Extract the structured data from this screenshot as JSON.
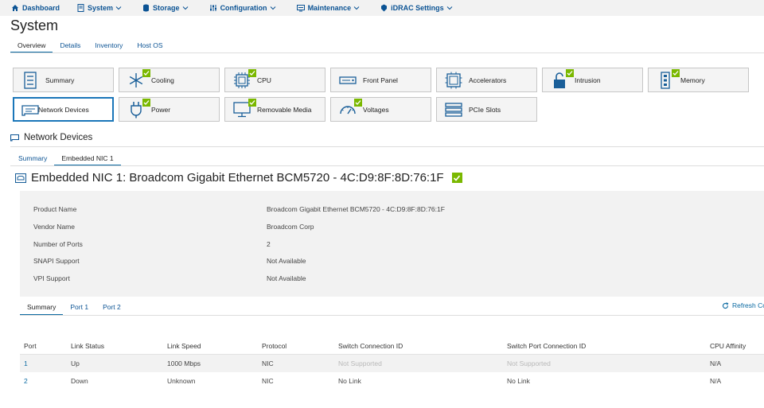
{
  "nav": [
    {
      "label": "Dashboard",
      "icon": "home-icon",
      "dropdown": false
    },
    {
      "label": "System",
      "icon": "server-icon",
      "dropdown": true
    },
    {
      "label": "Storage",
      "icon": "database-icon",
      "dropdown": true
    },
    {
      "label": "Configuration",
      "icon": "sliders-icon",
      "dropdown": true
    },
    {
      "label": "Maintenance",
      "icon": "monitor-icon",
      "dropdown": true
    },
    {
      "label": "iDRAC Settings",
      "icon": "badge-icon",
      "dropdown": true
    }
  ],
  "page_title": "System",
  "system_tabs": [
    "Overview",
    "Details",
    "Inventory",
    "Host OS"
  ],
  "tiles": [
    {
      "label": "Summary",
      "icon": "summary-icon",
      "check": false
    },
    {
      "label": "Cooling",
      "icon": "snowflake-icon",
      "check": true
    },
    {
      "label": "CPU",
      "icon": "cpu-icon",
      "check": true
    },
    {
      "label": "Front Panel",
      "icon": "front-panel-icon",
      "check": false
    },
    {
      "label": "Accelerators",
      "icon": "accelerator-icon",
      "check": false
    },
    {
      "label": "Intrusion",
      "icon": "lock-icon",
      "check": true
    },
    {
      "label": "Memory",
      "icon": "memory-icon",
      "check": true
    },
    {
      "label": "Network Devices",
      "icon": "network-card-icon",
      "check": false
    },
    {
      "label": "Power",
      "icon": "power-plug-icon",
      "check": true
    },
    {
      "label": "Removable Media",
      "icon": "removable-media-icon",
      "check": true
    },
    {
      "label": "Voltages",
      "icon": "gauge-icon",
      "check": true
    },
    {
      "label": "PCIe Slots",
      "icon": "pcie-slots-icon",
      "check": false
    }
  ],
  "section_title": "Network Devices",
  "section_tabs": [
    "Summary",
    "Embedded NIC 1"
  ],
  "nic_title": "Embedded NIC 1: Broadcom Gigabit Ethernet BCM5720 - 4C:D9:8F:8D:76:1F",
  "properties": [
    {
      "label": "Product Name",
      "value": "Broadcom Gigabit Ethernet BCM5720 - 4C:D9:8F:8D:76:1F"
    },
    {
      "label": "Vendor Name",
      "value": "Broadcom Corp"
    },
    {
      "label": "Number of Ports",
      "value": "2"
    },
    {
      "label": "SNAPI Support",
      "value": "Not Available"
    },
    {
      "label": "VPI Support",
      "value": "Not Available"
    }
  ],
  "port_tabs": [
    "Summary",
    "Port 1",
    "Port 2"
  ],
  "refresh_label": "Refresh Co",
  "ports_table": {
    "headers": [
      "Port",
      "Link Status",
      "Link Speed",
      "Protocol",
      "Switch Connection ID",
      "Switch Port Connection ID",
      "CPU Affinity"
    ],
    "rows": [
      [
        "1",
        "Up",
        "1000 Mbps",
        "NIC",
        "Not Supported",
        "Not Supported",
        "N/A"
      ],
      [
        "2",
        "Down",
        "Unknown",
        "NIC",
        "No Link",
        "No Link",
        "N/A"
      ]
    ]
  },
  "colors": {
    "accent": "#0b6aa2",
    "ok_green": "#7ab800",
    "tile_bg": "#f4f4f4",
    "panel_bg": "#f2f2f2"
  }
}
